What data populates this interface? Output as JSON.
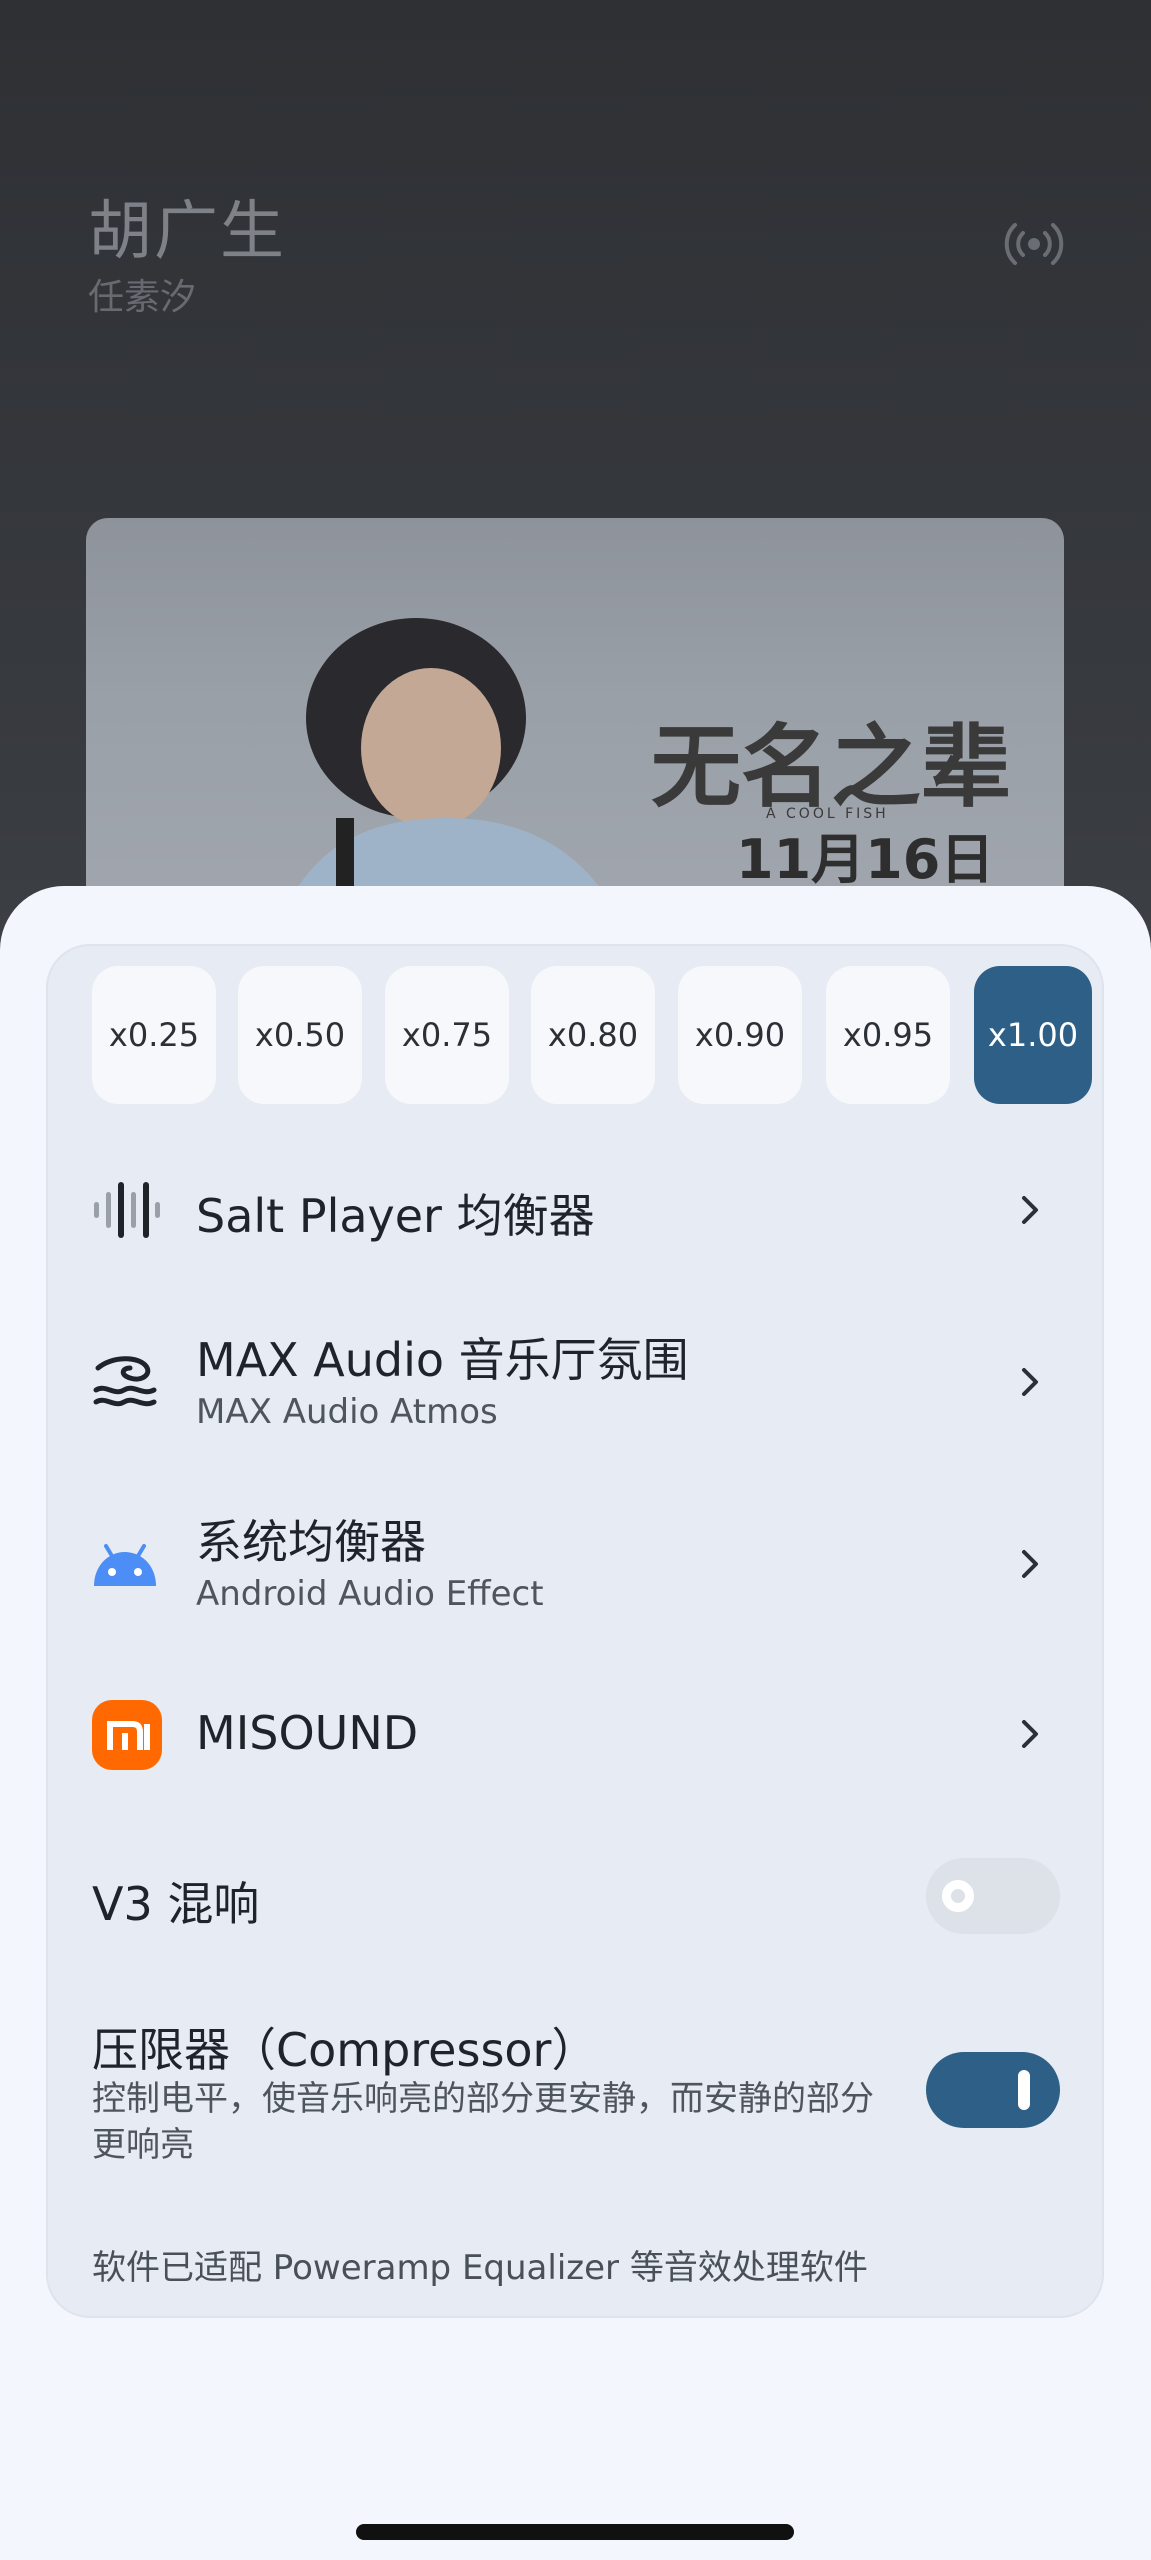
{
  "now_playing": {
    "title": "胡广生",
    "artist": "任素汐",
    "album_poster_text": "无名之辈",
    "album_poster_subtitle": "A COOL FISH",
    "album_poster_date": "11月16日"
  },
  "speed_options": [
    "x0.25",
    "x0.50",
    "x0.75",
    "x0.80",
    "x0.90",
    "x0.95",
    "x1.00"
  ],
  "speed_selected": "x1.00",
  "effects": [
    {
      "label": "Salt Player 均衡器",
      "icon": "equalizer-bars-icon"
    },
    {
      "label": "MAX Audio 音乐厅氛围",
      "sub": "MAX Audio Atmos",
      "icon": "max-audio-logo-icon"
    },
    {
      "label": "系统均衡器",
      "sub": "Android Audio Effect",
      "icon": "android-icon"
    },
    {
      "label": "MISOUND",
      "icon": "mi-logo-icon"
    }
  ],
  "v3_reverb": {
    "label": "V3 混响",
    "enabled": false
  },
  "compressor": {
    "label": "压限器（Compressor）",
    "description": "控制电平，使音乐响亮的部分更安静，而安静的部分更响亮",
    "enabled": true
  },
  "footer_note": "软件已适配 Poweramp Equalizer 等音效处理软件",
  "colors": {
    "accent": "#2e5f87",
    "sheet_bg": "#f3f6fc",
    "card_bg": "#e7ebf3",
    "android_green": "#4c8df6",
    "mi_orange": "#ff6900"
  }
}
